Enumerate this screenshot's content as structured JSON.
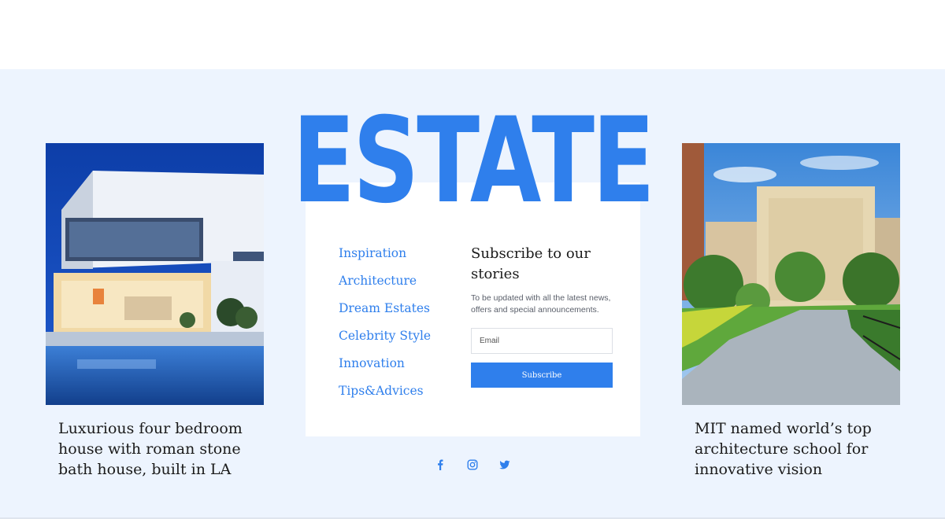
{
  "brand": {
    "logo_text": "ESTATE",
    "accent_color": "#2f7fec",
    "background_color": "#edf4fe"
  },
  "left_card": {
    "image": "modern-villa-with-pool-at-night",
    "title": "Luxurious four bedroom house with roman stone bath house, built in LA"
  },
  "right_card": {
    "image": "city-park-with-buildings",
    "title": "MIT named world’s top architecture school for innovative vision"
  },
  "nav": {
    "items": [
      {
        "label": "Inspiration"
      },
      {
        "label": "Architecture"
      },
      {
        "label": "Dream Estates"
      },
      {
        "label": "Celebrity Style"
      },
      {
        "label": "Innovation"
      },
      {
        "label": "Tips&Advices"
      }
    ]
  },
  "subscribe": {
    "title": "Subscribe to our stories",
    "description": "To be updated with all the latest news, offers and special announcements.",
    "email_placeholder": "Email",
    "button_label": "Subscribe"
  },
  "social": {
    "icons": [
      "facebook-icon",
      "instagram-icon",
      "twitter-icon"
    ]
  }
}
